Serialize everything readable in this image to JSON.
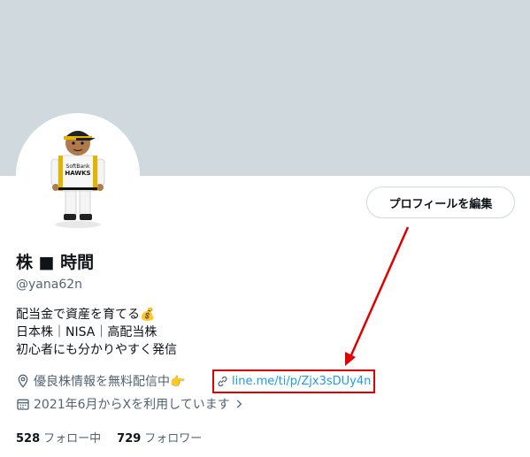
{
  "profile": {
    "display_name": "株 ■ 時間",
    "handle": "@yana62n",
    "edit_button_label": "プロフィールを編集",
    "bio_lines": [
      "配当金で資産を育てる💰",
      "日本株｜NISA｜高配当株",
      "初心者にも分かりやすく発信"
    ],
    "location": "優良株情報を無料配信中👉",
    "link": "line.me/ti/p/Zjx3sDUy4n",
    "joined": "2021年6月からXを利用しています",
    "following": {
      "count": "528",
      "label": "フォロー中"
    },
    "followers": {
      "count": "729",
      "label": "フォロワー"
    }
  },
  "icons": {
    "location": "location-pin-icon",
    "link": "link-icon",
    "calendar": "calendar-icon",
    "chevron": "chevron-right-icon"
  },
  "colors": {
    "banner": "#cfd9de",
    "link": "#1d9bf0",
    "annotation": "#e00000",
    "secondary_text": "#536471"
  }
}
